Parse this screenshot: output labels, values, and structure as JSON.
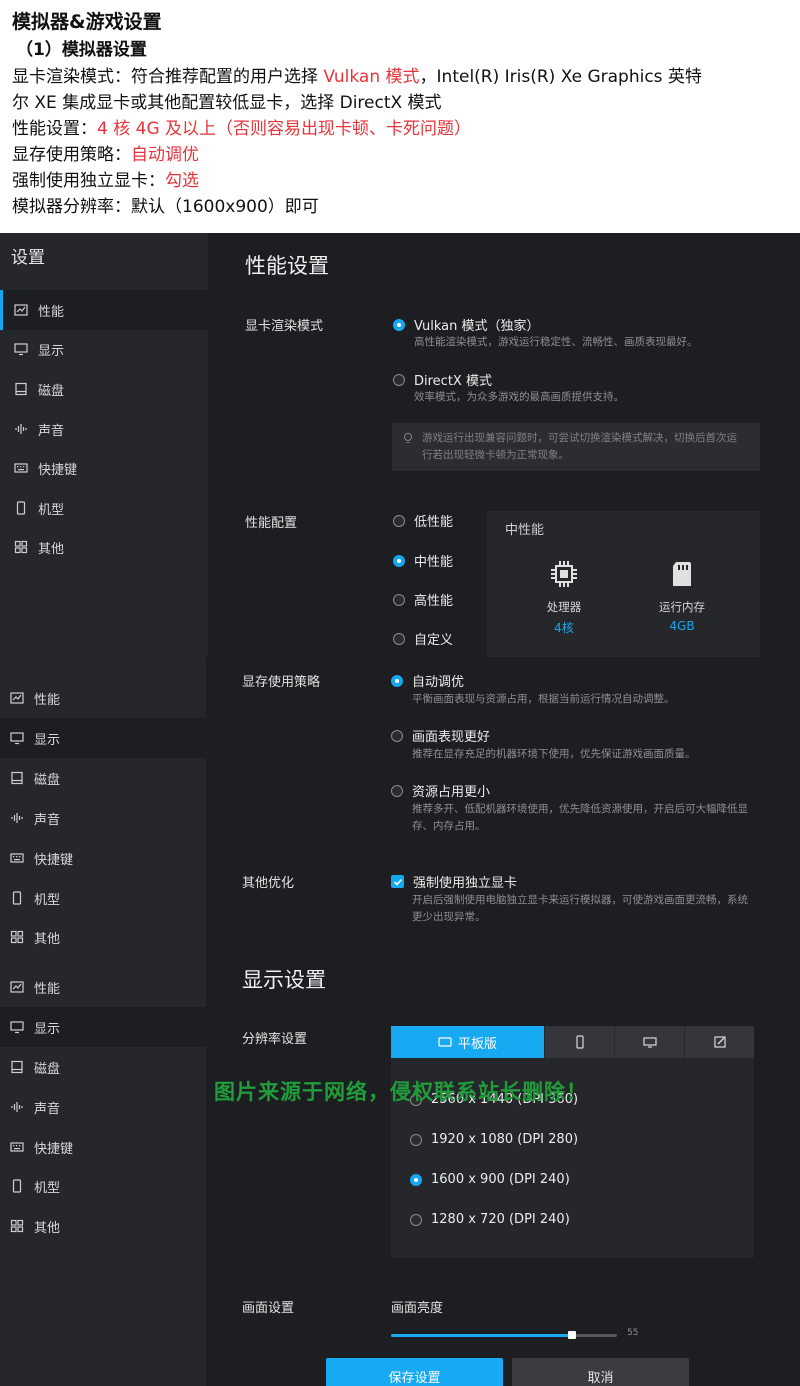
{
  "doc": {
    "title": "模拟器&游戏设置",
    "subtitle": "（1）模拟器设置",
    "line1_a": "显卡渲染模式：符合推荐配置的用户选择 ",
    "line1_b": "Vulkan 模式",
    "line1_c": "，Intel(R) Iris(R) Xe Graphics 英特",
    "line2": "尔 XE 集成显卡或其他配置较低显卡，选择 DirectX 模式",
    "line3_a": "性能设置：",
    "line3_b": "4 核 4G 及以上（否则容易出现卡顿、卡死问题）",
    "line4_a": "显存使用策略：",
    "line4_b": "自动调优",
    "line5_a": "强制使用独立显卡：",
    "line5_b": "勾选",
    "line6": "模拟器分辨率：默认（1600x900）即可"
  },
  "nav": {
    "settings_title": "设置",
    "performance": "性能",
    "display": "显示",
    "disk": "磁盘",
    "sound": "声音",
    "shortcuts": "快捷键",
    "model": "机型",
    "other": "其他"
  },
  "perf": {
    "title": "性能设置",
    "render_label": "显卡渲染模式",
    "vulkan": "Vulkan 模式（独家）",
    "vulkan_desc": "高性能渲染模式，游戏运行稳定性、流畅性、画质表现最好。",
    "directx": "DirectX 模式",
    "directx_desc": "效率模式，为众多游戏的最高画质提供支持。",
    "tip_line1": "游戏运行出现兼容问题时，可尝试切换渲染模式解决，切换后首次运",
    "tip_line2": "行若出现轻微卡顿为正常现象。",
    "config_label": "性能配置",
    "low": "低性能",
    "mid": "中性能",
    "high": "高性能",
    "custom": "自定义",
    "box_title": "中性能",
    "cpu_label": "处理器",
    "cpu_value": "4核",
    "ram_label": "运行内存",
    "ram_value": "4GB"
  },
  "vram": {
    "label": "显存使用策略",
    "auto": "自动调优",
    "auto_desc": "平衡画面表现与资源占用，根据当前运行情况自动调整。",
    "quality": "画面表现更好",
    "quality_desc": "推荐在显存充足的机器环境下使用，优先保证游戏画面质量。",
    "less": "资源占用更小",
    "less_desc1": "推荐多开、低配机器环境使用，优先降低资源使用，开启后可大幅降低显",
    "less_desc2": "存、内存占用。",
    "other_label": "其他优化",
    "force_gpu": "强制使用独立显卡",
    "force_desc1": "开启后强制使用电脑独立显卡来运行模拟器，可使游戏画面更流畅，系统",
    "force_desc2": "更少出现异常。"
  },
  "display": {
    "title": "显示设置",
    "res_label": "分辨率设置",
    "tab_tablet": "平板版",
    "res1": "2560 x 1440 (DPI 360)",
    "res2": "1920 x 1080 (DPI 280)",
    "res3": "1600 x 900 (DPI 240)",
    "res4": "1280 x 720 (DPI 240)",
    "watermark": "图片来源于网络，侵权联系站长删除！",
    "screen_label": "画面设置",
    "brightness_label": "画面亮度",
    "brightness_value": 0.8,
    "brightness_num": "55",
    "save": "保存设置",
    "cancel": "取消"
  },
  "colors": {
    "accent": "#14a8f0",
    "highlight_text": "#e8333a",
    "watermark": "#1f9d3a"
  }
}
